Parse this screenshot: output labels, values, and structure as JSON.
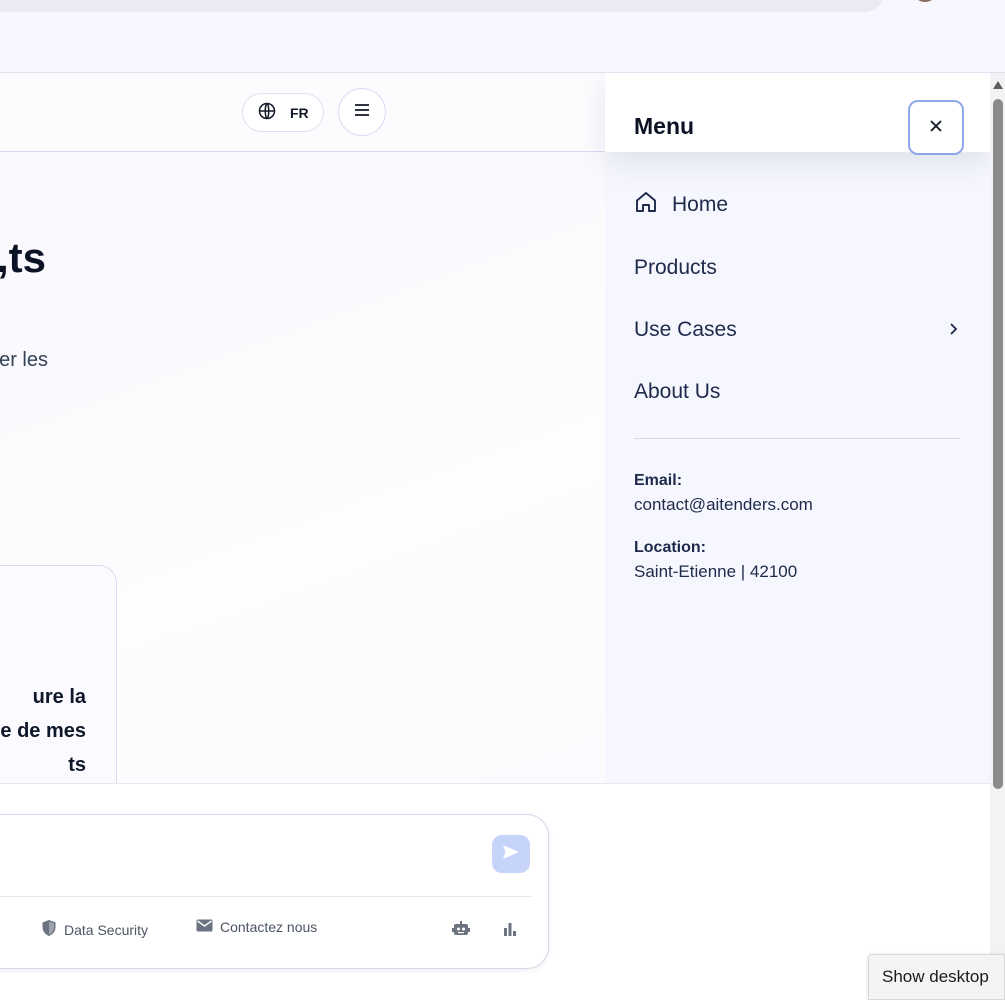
{
  "header": {
    "lang_label": "FR"
  },
  "hero": {
    "title_fragment": "ts,",
    "subtitle_fragment": "er les"
  },
  "card": {
    "lines": [
      "ure la",
      "e de mes",
      "ts"
    ]
  },
  "menu": {
    "title": "Menu",
    "items": [
      {
        "label": "Home",
        "icon": "home-icon"
      },
      {
        "label": "Products"
      },
      {
        "label": "Use Cases",
        "icon": "chevron-right-icon"
      },
      {
        "label": "About Us"
      }
    ],
    "email_label": "Email:",
    "email_value": "contact@aitenders.com",
    "location_label": "Location:",
    "location_value": "Saint-Etienne | 42100"
  },
  "chat": {
    "links": [
      {
        "label": "Data Security",
        "icon": "shield-icon"
      },
      {
        "label": "Contactez nous",
        "icon": "mail-icon"
      }
    ]
  },
  "tooltip": {
    "show_desktop": "Show desktop"
  },
  "colors": {
    "accent": "#8fa6ea",
    "send_button": "#c7d4fa"
  }
}
